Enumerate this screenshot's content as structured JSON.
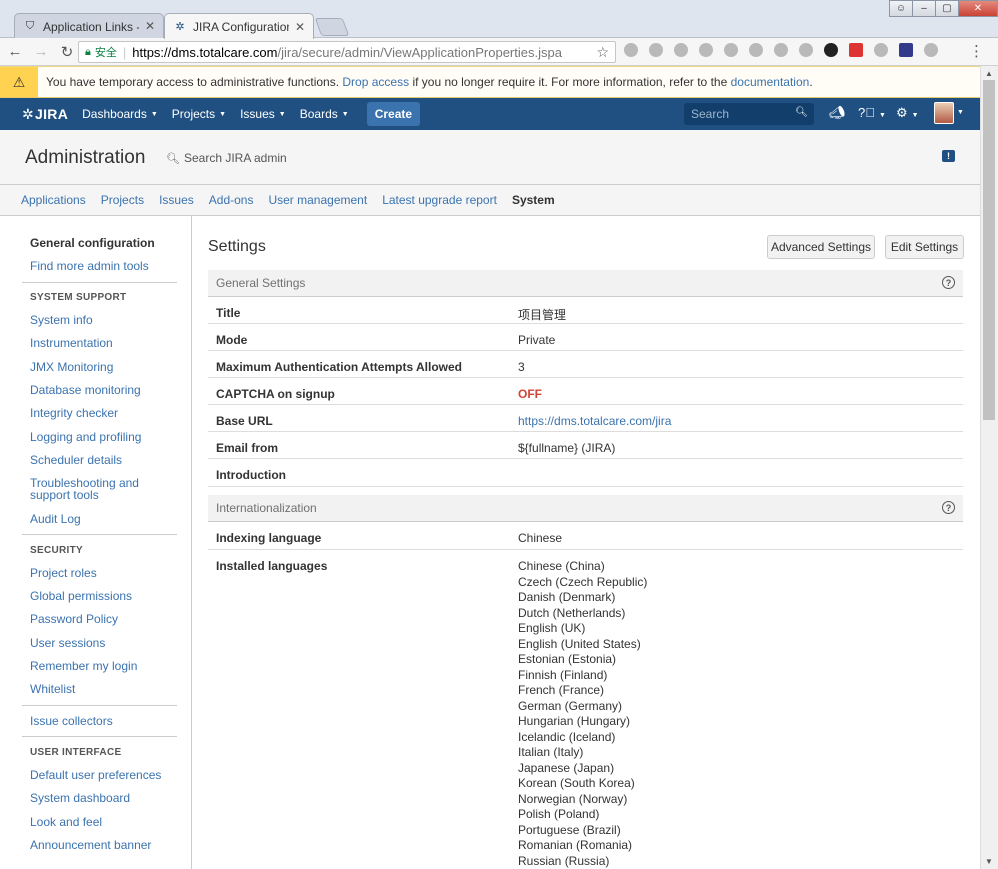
{
  "browser": {
    "tabs": [
      {
        "title": "Application Links - 代理",
        "icon": "jira-icon"
      },
      {
        "title": "JIRA Configuration - 项",
        "icon": "jira-icon"
      }
    ],
    "secure_label": "安全",
    "url_host": "https://dms.totalcare.com",
    "url_path": "/jira/secure/admin/ViewApplicationProperties.jspa"
  },
  "warning": {
    "text_before": "You have temporary access to administrative functions.",
    "drop_link": "Drop access",
    "text_middle": "if you no longer require it. For more information, refer to the",
    "doc_link": "documentation",
    "text_after": "."
  },
  "header": {
    "logo": "JIRA",
    "nav": [
      "Dashboards",
      "Projects",
      "Issues",
      "Boards"
    ],
    "create_label": "Create",
    "search_placeholder": "Search"
  },
  "admin": {
    "title": "Administration",
    "search_label": "Search JIRA admin",
    "tabs": [
      "Applications",
      "Projects",
      "Issues",
      "Add-ons",
      "User management",
      "Latest upgrade report",
      "System"
    ],
    "active_tab": "System"
  },
  "sidebar": {
    "general": "General configuration",
    "find_more": "Find more admin tools",
    "system_support_header": "SYSTEM SUPPORT",
    "system_support": [
      "System info",
      "Instrumentation",
      "JMX Monitoring",
      "Database monitoring",
      "Integrity checker",
      "Logging and profiling",
      "Scheduler details",
      "Troubleshooting and support tools",
      "Audit Log"
    ],
    "security_header": "SECURITY",
    "security": [
      "Project roles",
      "Global permissions",
      "Password Policy",
      "User sessions",
      "Remember my login",
      "Whitelist"
    ],
    "issue_collectors": "Issue collectors",
    "user_interface_header": "USER INTERFACE",
    "user_interface": [
      "Default user preferences",
      "System dashboard",
      "Look and feel",
      "Announcement banner"
    ]
  },
  "main": {
    "title": "Settings",
    "advanced_button": "Advanced Settings",
    "edit_button": "Edit Settings",
    "general_header": "General Settings",
    "general_rows": [
      {
        "label": "Title",
        "value": "项目管理"
      },
      {
        "label": "Mode",
        "value": "Private"
      },
      {
        "label": "Maximum Authentication Attempts Allowed",
        "value": "3"
      },
      {
        "label": "CAPTCHA on signup",
        "value": "OFF"
      },
      {
        "label": "Base URL",
        "value": "https://dms.totalcare.com/jira"
      },
      {
        "label": "Email from",
        "value": "${fullname} (JIRA)"
      },
      {
        "label": "Introduction",
        "value": ""
      }
    ],
    "i18n_header": "Internationalization",
    "indexing_label": "Indexing language",
    "indexing_value": "Chinese",
    "installed_label": "Installed languages",
    "languages": [
      "Chinese (China)",
      "Czech (Czech Republic)",
      "Danish (Denmark)",
      "Dutch (Netherlands)",
      "English (UK)",
      "English (United States)",
      "Estonian (Estonia)",
      "Finnish (Finland)",
      "French (France)",
      "German (Germany)",
      "Hungarian (Hungary)",
      "Icelandic (Iceland)",
      "Italian (Italy)",
      "Japanese (Japan)",
      "Korean (South Korea)",
      "Norwegian (Norway)",
      "Polish (Poland)",
      "Portuguese (Brazil)",
      "Romanian (Romania)",
      "Russian (Russia)"
    ]
  },
  "colors": {
    "header_bg": "#205081",
    "link": "#3b73af",
    "off": "#d04437",
    "warning": "#ffd351"
  }
}
